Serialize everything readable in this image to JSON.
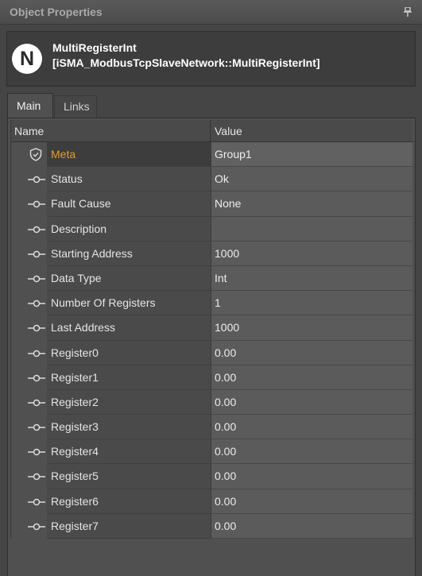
{
  "panel": {
    "title": "Object Properties"
  },
  "object": {
    "icon_letter": "N",
    "name": "MultiRegisterInt",
    "type": "[iSMA_ModbusTcpSlaveNetwork::MultiRegisterInt]"
  },
  "tabs": [
    {
      "label": "Main"
    },
    {
      "label": "Links"
    }
  ],
  "grid": {
    "columns": [
      "Name",
      "Value"
    ],
    "rows": [
      {
        "name": "Meta",
        "value": "Group1"
      },
      {
        "name": "Status",
        "value": "Ok"
      },
      {
        "name": "Fault Cause",
        "value": "None"
      },
      {
        "name": "Description",
        "value": ""
      },
      {
        "name": "Starting Address",
        "value": "1000"
      },
      {
        "name": "Data Type",
        "value": "Int"
      },
      {
        "name": "Number Of Registers",
        "value": "1"
      },
      {
        "name": "Last Address",
        "value": "1000"
      },
      {
        "name": "Register0",
        "value": "0.00"
      },
      {
        "name": "Register1",
        "value": "0.00"
      },
      {
        "name": "Register2",
        "value": "0.00"
      },
      {
        "name": "Register3",
        "value": "0.00"
      },
      {
        "name": "Register4",
        "value": "0.00"
      },
      {
        "name": "Register5",
        "value": "0.00"
      },
      {
        "name": "Register6",
        "value": "0.00"
      },
      {
        "name": "Register7",
        "value": "0.00"
      }
    ]
  },
  "colors": {
    "meta_label": "#e59a2a",
    "background": "#454545"
  }
}
